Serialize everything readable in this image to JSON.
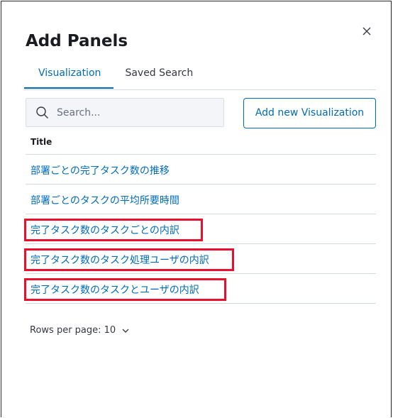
{
  "modal": {
    "title": "Add Panels",
    "close_icon": "close-icon"
  },
  "tabs": [
    {
      "label": "Visualization",
      "active": true
    },
    {
      "label": "Saved Search",
      "active": false
    }
  ],
  "search": {
    "placeholder": "Search...",
    "value": "",
    "icon": "search-icon"
  },
  "toolbar": {
    "add_label": "Add new Visualization"
  },
  "table": {
    "header": "Title",
    "rows": [
      {
        "title": "部署ごとの完了タスク数の推移",
        "highlighted": false
      },
      {
        "title": "部署ごとのタスクの平均所要時間",
        "highlighted": false
      },
      {
        "title": "完了タスク数のタスクごとの内訳",
        "highlighted": true
      },
      {
        "title": "完了タスク数のタスク処理ユーザの内訳",
        "highlighted": true
      },
      {
        "title": "完了タスク数のタスクとユーザの内訳",
        "highlighted": true
      }
    ]
  },
  "pagination": {
    "rows_per_page_label": "Rows per page: 10",
    "icon": "chevron-down-icon"
  },
  "colors": {
    "accent": "#006bb8",
    "highlight": "#e8112d",
    "border": "#d3dae6",
    "search_bg": "#f3f5f9"
  }
}
